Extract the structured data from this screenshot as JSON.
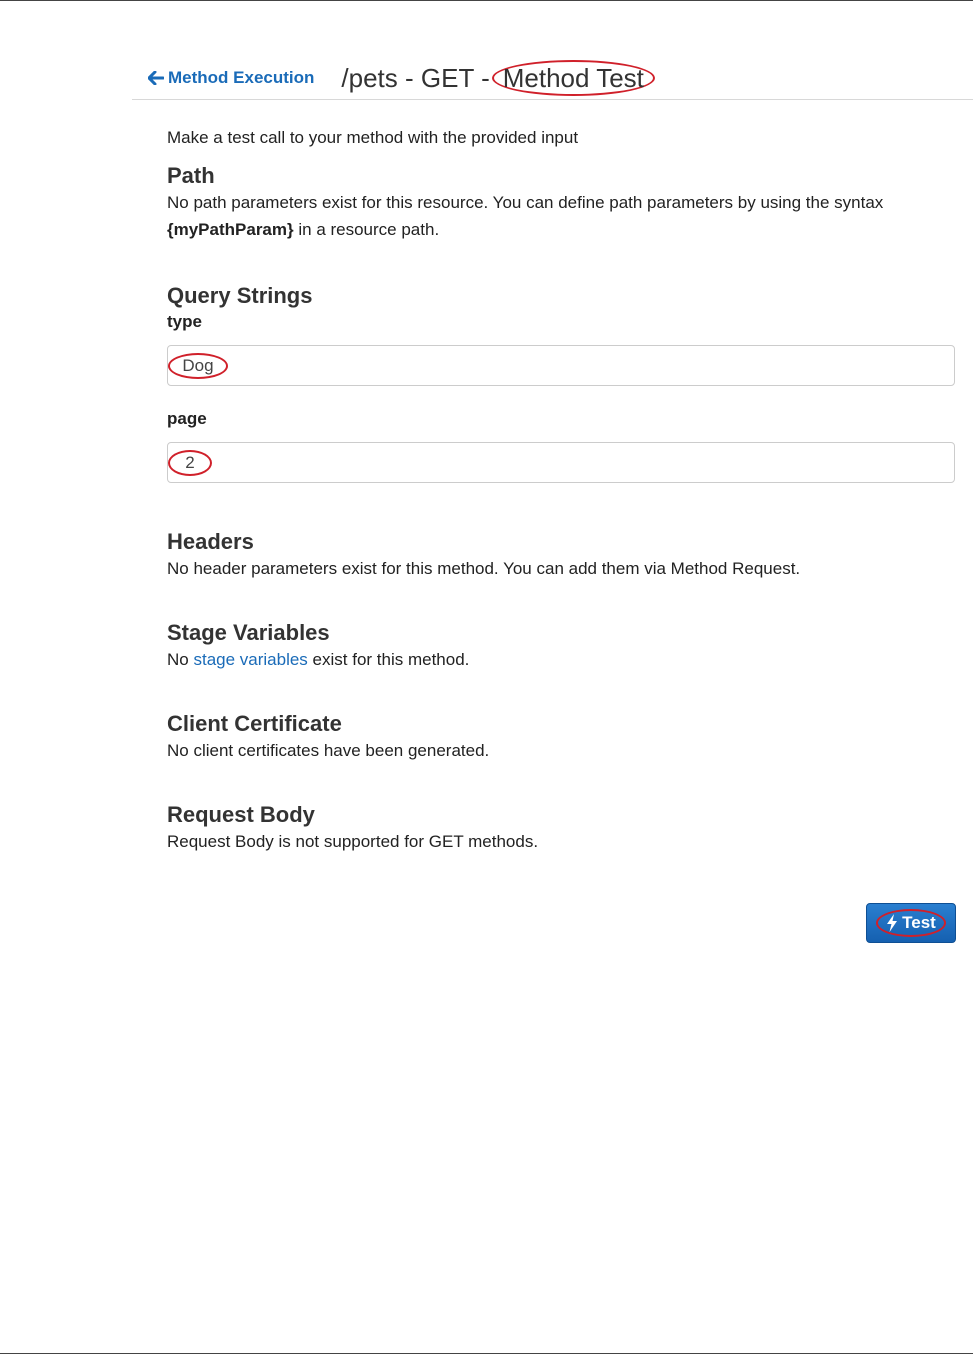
{
  "header": {
    "back_label": "Method Execution",
    "title_prefix": "/pets - GET -",
    "title_highlight": "Method Test"
  },
  "intro": "Make a test call to your method with the provided input",
  "path": {
    "title": "Path",
    "text_before": "No path parameters exist for this resource. You can define path parameters by using the syntax",
    "syntax": "{myPathParam}",
    "text_after": "in a resource path."
  },
  "query": {
    "title": "Query Strings",
    "fields": [
      {
        "label": "type",
        "value": "Dog"
      },
      {
        "label": "page",
        "value": "2"
      }
    ]
  },
  "headers": {
    "title": "Headers",
    "text": "No header parameters exist for this method. You can add them via Method Request."
  },
  "stage": {
    "title": "Stage Variables",
    "text_before": "No",
    "link": "stage variables",
    "text_after": "exist for this method."
  },
  "client_cert": {
    "title": "Client Certificate",
    "text": "No client certificates have been generated."
  },
  "request_body": {
    "title": "Request Body",
    "text": "Request Body is not supported for GET methods."
  },
  "test_button": {
    "label": "Test",
    "icon": "bolt-icon"
  },
  "colors": {
    "link": "#1a6bb8",
    "annotation": "#d0202a",
    "button": "#1560b0"
  }
}
